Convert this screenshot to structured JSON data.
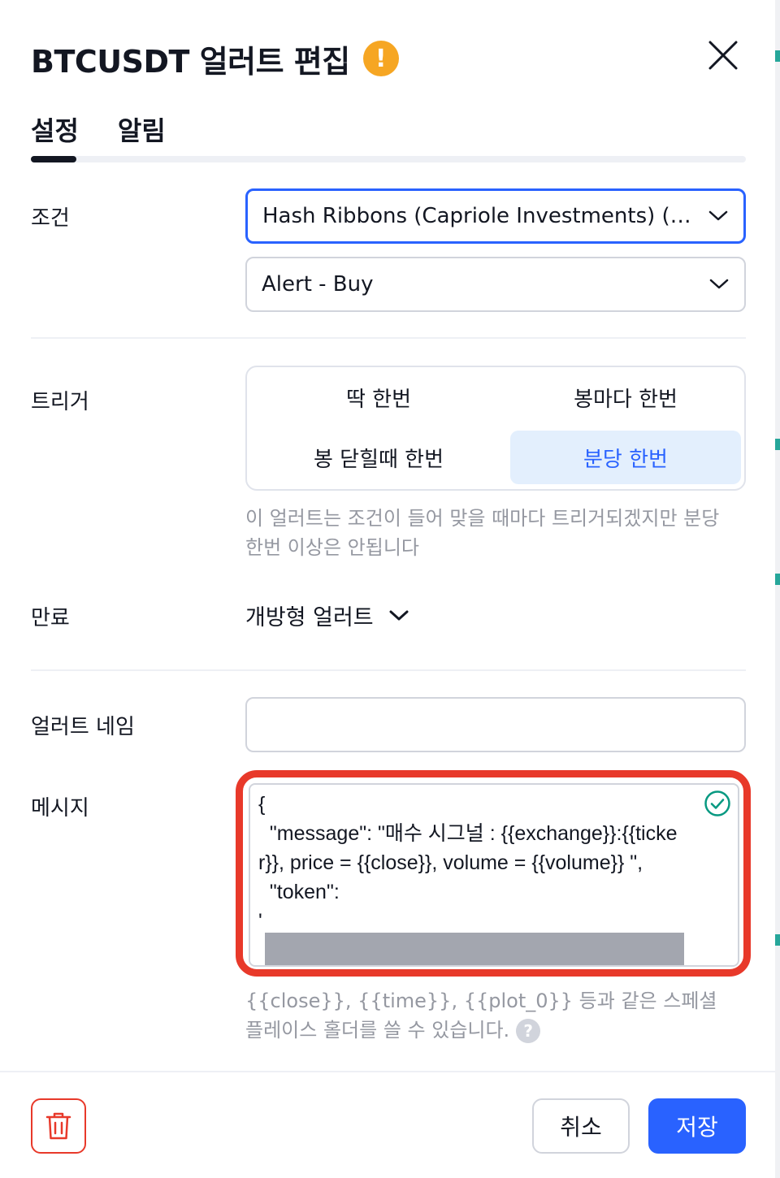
{
  "header": {
    "title": "BTCUSDT 얼러트 편집",
    "warning_glyph": "!"
  },
  "tabs": [
    {
      "label": "설정",
      "active": true
    },
    {
      "label": "알림",
      "active": false
    }
  ],
  "condition": {
    "label": "조건",
    "primary_value": "Hash Ribbons (Capriole Investments) (R...",
    "secondary_value": "Alert - Buy"
  },
  "trigger": {
    "label": "트리거",
    "options": [
      {
        "label": "딱 한번",
        "selected": false
      },
      {
        "label": "봉마다 한번",
        "selected": false
      },
      {
        "label": "봉 닫힐때 한번",
        "selected": false
      },
      {
        "label": "분당 한번",
        "selected": true
      }
    ],
    "hint": "이 얼러트는 조건이 들어 맞을 때마다 트리거되겠지만 분당 한번 이상은 안됩니다"
  },
  "expiry": {
    "label": "만료",
    "value": "개방형 얼러트"
  },
  "alert_name": {
    "label": "얼러트 네임",
    "value": ""
  },
  "message": {
    "label": "메시지",
    "value": "{\n  \"message\": \"매수 시그널 : {{exchange}}:{{ticker}}, price = {{close}}, volume = {{volume}} \",\n  \"token\":\n'",
    "hint": "{{close}}, {{time}}, {{plot_0}} 등과 같은 스페셜 플레이스 홀더를 쓸 수 있습니다.",
    "help_glyph": "?"
  },
  "footer": {
    "cancel_label": "취소",
    "save_label": "저장"
  },
  "colors": {
    "accent": "#2962ff",
    "warning": "#f6a623",
    "danger": "#e8392a",
    "success": "#089981",
    "selected_bg": "#e3effd"
  }
}
